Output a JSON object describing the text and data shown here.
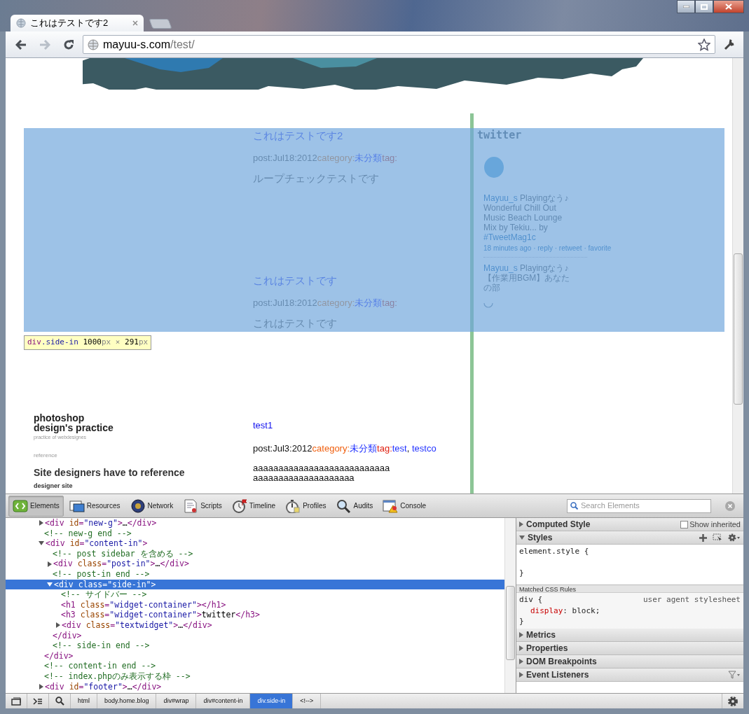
{
  "window": {
    "tab_title": "これはテストです2",
    "url_host": "mayuu-s.com",
    "url_path": "/test/"
  },
  "nav_buttons": [
    {
      "kind": "back",
      "disabled": false
    },
    {
      "kind": "forward",
      "disabled": true
    },
    {
      "kind": "reload",
      "disabled": false
    }
  ],
  "page": {
    "posts": [
      {
        "title": "これはテストです2",
        "date": "post:Jul18:2012",
        "category_label": "category:",
        "category": "未分類",
        "tag_label": "tag:",
        "body": [
          "ループチェックテストです"
        ]
      },
      {
        "title": "これはテストです",
        "date": "post:Jul18:2012",
        "category_label": "category:",
        "category": "未分類",
        "tag_label": "tag:",
        "body": [
          "これはテストです"
        ]
      }
    ],
    "sidebar": {
      "heading": "twitter",
      "tweets": [
        {
          "user": "Mayuu_s",
          "text": "Playingなう♪ Wonderful Chill Out Music Beach Lounge Mix by Tekiu... by",
          "hashtag": "#TweetMag1c",
          "meta": [
            "18 minutes ago",
            "reply",
            "retweet",
            "favorite"
          ],
          "separator": "·"
        },
        {
          "user": "Mayuu_s",
          "text": "Playingなう♪ 【作業用BGM】あなたの部"
        }
      ]
    },
    "highlight": {
      "tokens": [
        {
          "kind": "tag",
          "text": "div"
        },
        {
          "kind": "cls",
          "text": ".side-in"
        },
        {
          "kind": "num",
          "text": " 1000"
        },
        {
          "kind": "unit",
          "text": "px"
        },
        {
          "kind": "unit",
          "text": " × "
        },
        {
          "kind": "num",
          "text": "291"
        },
        {
          "kind": "unit",
          "text": "px"
        }
      ]
    },
    "site": {
      "title_lines": [
        "photoshop",
        "design's practice"
      ],
      "tagline": "practice of webdesignes",
      "section_label": "reference",
      "heading": "Site designers have to reference",
      "subheading": "designer site"
    },
    "archive_post": {
      "title": "test1",
      "date": "post:Jul3:2012",
      "category_label": "category:",
      "category": "未分類",
      "tag_label": "tag:",
      "tags": [
        {
          "name": "test",
          "separator": ","
        },
        {
          "name": "testco"
        }
      ],
      "body": [
        "aaaaaaaaaaaaaaaaaaaaaaaaaaa",
        "aaaaaaaaaaaaaaaaaaaa"
      ]
    }
  },
  "devtools": {
    "tabs": [
      {
        "label": "Elements",
        "selected": true
      },
      {
        "label": "Resources",
        "selected": false
      },
      {
        "label": "Network",
        "selected": false
      },
      {
        "label": "Scripts",
        "selected": false
      },
      {
        "label": "Timeline",
        "selected": false
      },
      {
        "label": "Profiles",
        "selected": false
      },
      {
        "label": "Audits",
        "selected": false
      },
      {
        "label": "Console",
        "selected": false
      }
    ],
    "search": {
      "placeholder": "Search Elements"
    },
    "dom": [
      {
        "kind": "element",
        "expanded": false,
        "selected": false,
        "tokens": [
          {
            "kind": "tag",
            "text": "<div "
          },
          {
            "kind": "attr",
            "text": "id"
          },
          {
            "kind": "tag",
            "text": "="
          },
          {
            "kind": "val",
            "text": "\"new-g\""
          },
          {
            "kind": "tag",
            "text": ">"
          },
          {
            "kind": "text",
            "text": "…"
          },
          {
            "kind": "tag",
            "text": "</div>"
          }
        ]
      },
      {
        "kind": "comment",
        "selected": false,
        "tokens": [
          {
            "kind": "comment",
            "text": "<!-- new-g end -->"
          }
        ]
      },
      {
        "kind": "element",
        "expanded": true,
        "selected": false,
        "tokens": [
          {
            "kind": "tag",
            "text": "<div "
          },
          {
            "kind": "attr",
            "text": "id"
          },
          {
            "kind": "tag",
            "text": "="
          },
          {
            "kind": "val",
            "text": "\"content-in\""
          },
          {
            "kind": "tag",
            "text": ">"
          }
        ],
        "close": [
          {
            "kind": "tag",
            "text": "</div>"
          }
        ],
        "children": [
          {
            "kind": "comment",
            "selected": false,
            "tokens": [
              {
                "kind": "comment",
                "text": "<!-- post sidebar を含める -->"
              }
            ]
          },
          {
            "kind": "element",
            "expanded": false,
            "selected": false,
            "tokens": [
              {
                "kind": "tag",
                "text": "<div "
              },
              {
                "kind": "attr",
                "text": "class"
              },
              {
                "kind": "tag",
                "text": "="
              },
              {
                "kind": "val",
                "text": "\"post-in\""
              },
              {
                "kind": "tag",
                "text": ">"
              },
              {
                "kind": "text",
                "text": "…"
              },
              {
                "kind": "tag",
                "text": "</div>"
              }
            ]
          },
          {
            "kind": "comment",
            "selected": false,
            "tokens": [
              {
                "kind": "comment",
                "text": "<!-- post-in end -->"
              }
            ]
          },
          {
            "kind": "element",
            "expanded": true,
            "selected": true,
            "tokens": [
              {
                "kind": "tag",
                "text": "<div "
              },
              {
                "kind": "attr",
                "text": "class"
              },
              {
                "kind": "tag",
                "text": "="
              },
              {
                "kind": "val",
                "text": "\"side-in\""
              },
              {
                "kind": "tag",
                "text": ">"
              }
            ],
            "close": [
              {
                "kind": "tag",
                "text": "</div>"
              }
            ],
            "children": [
              {
                "kind": "comment",
                "selected": false,
                "tokens": [
                  {
                    "kind": "comment",
                    "text": "<!-- サイドバー -->"
                  }
                ]
              },
              {
                "kind": "leaf",
                "selected": false,
                "tokens": [
                  {
                    "kind": "tag",
                    "text": "<h1 "
                  },
                  {
                    "kind": "attr",
                    "text": "class"
                  },
                  {
                    "kind": "tag",
                    "text": "="
                  },
                  {
                    "kind": "val",
                    "text": "\"widget-container\""
                  },
                  {
                    "kind": "tag",
                    "text": "></h1>"
                  }
                ]
              },
              {
                "kind": "leaf",
                "selected": false,
                "tokens": [
                  {
                    "kind": "tag",
                    "text": "<h3 "
                  },
                  {
                    "kind": "attr",
                    "text": "class"
                  },
                  {
                    "kind": "tag",
                    "text": "="
                  },
                  {
                    "kind": "val",
                    "text": "\"widget-container\""
                  },
                  {
                    "kind": "tag",
                    "text": ">"
                  },
                  {
                    "kind": "text",
                    "text": "twitter"
                  },
                  {
                    "kind": "tag",
                    "text": "</h3>"
                  }
                ]
              },
              {
                "kind": "element",
                "expanded": false,
                "selected": false,
                "tokens": [
                  {
                    "kind": "tag",
                    "text": "<div "
                  },
                  {
                    "kind": "attr",
                    "text": "class"
                  },
                  {
                    "kind": "tag",
                    "text": "="
                  },
                  {
                    "kind": "val",
                    "text": "\"textwidget\""
                  },
                  {
                    "kind": "tag",
                    "text": ">"
                  },
                  {
                    "kind": "text",
                    "text": "…"
                  },
                  {
                    "kind": "tag",
                    "text": "</div>"
                  }
                ]
              }
            ]
          },
          {
            "kind": "comment",
            "selected": false,
            "tokens": [
              {
                "kind": "comment",
                "text": "<!-- side-in end -->"
              }
            ]
          }
        ]
      },
      {
        "kind": "comment",
        "selected": false,
        "tokens": [
          {
            "kind": "comment",
            "text": "<!-- content-in end -->"
          }
        ]
      },
      {
        "kind": "comment",
        "selected": false,
        "tokens": [
          {
            "kind": "comment",
            "text": "<!-- index.phpのみ表示する枠 -->"
          }
        ]
      },
      {
        "kind": "element",
        "expanded": false,
        "selected": false,
        "tokens": [
          {
            "kind": "tag",
            "text": "<div "
          },
          {
            "kind": "attr",
            "text": "id"
          },
          {
            "kind": "tag",
            "text": "="
          },
          {
            "kind": "val",
            "text": "\"footer\""
          },
          {
            "kind": "tag",
            "text": ">"
          },
          {
            "kind": "text",
            "text": "…"
          },
          {
            "kind": "tag",
            "text": "</div>"
          }
        ]
      }
    ],
    "breadcrumbs": [
      {
        "label": "html",
        "selected": false
      },
      {
        "label": "body.home.blog",
        "selected": false
      },
      {
        "label": "div#wrap",
        "selected": false
      },
      {
        "label": "div#content-in",
        "selected": false
      },
      {
        "label": "div.side-in",
        "selected": true
      },
      {
        "label": "<!-->",
        "selected": false
      }
    ],
    "panes": [
      {
        "kind": "computed",
        "title": "Computed Style",
        "expanded": false,
        "option": {
          "label": "Show inherited",
          "checked": false
        }
      },
      {
        "kind": "styles",
        "title": "Styles",
        "expanded": true
      },
      {
        "kind": "plain",
        "title": "Metrics",
        "expanded": false
      },
      {
        "kind": "plain",
        "title": "Properties",
        "expanded": false
      },
      {
        "kind": "plain",
        "title": "DOM Breakpoints",
        "expanded": false
      },
      {
        "kind": "listeners",
        "title": "Event Listeners",
        "expanded": false
      }
    ],
    "styles": {
      "element_rule": {
        "selector": "element.style {",
        "close": "}"
      },
      "matched_header": "Matched CSS Rules",
      "rules": [
        {
          "selector": "div {",
          "origin": "user agent stylesheet",
          "props": [
            {
              "name": "display",
              "value": ": block;"
            }
          ],
          "close": "}"
        }
      ]
    }
  }
}
